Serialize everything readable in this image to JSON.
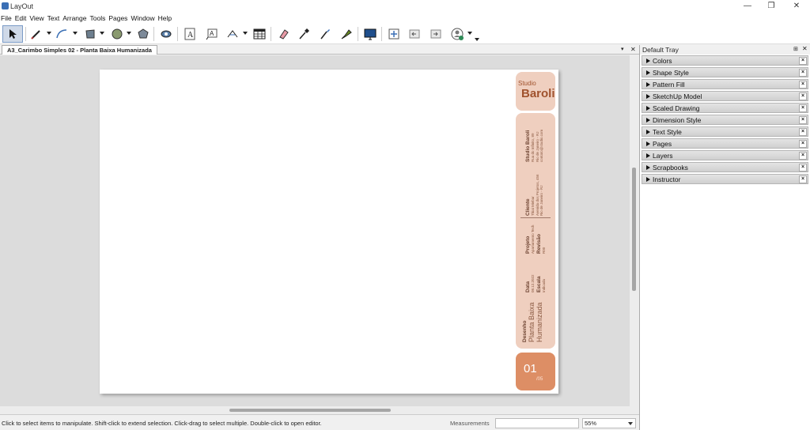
{
  "window": {
    "title": "LayOut",
    "minimize": "—",
    "maximize": "❐",
    "close": "✕"
  },
  "menu": [
    "File",
    "Edit",
    "View",
    "Text",
    "Arrange",
    "Tools",
    "Pages",
    "Window",
    "Help"
  ],
  "toolbar": {
    "tools": [
      "select",
      "line",
      "arc",
      "rectangle",
      "circle",
      "polygon",
      "style",
      "text",
      "label",
      "dimension",
      "table",
      "erase",
      "sample",
      "paint",
      "split",
      "presentation",
      "add-page",
      "previous-page",
      "next-page",
      "instructor"
    ]
  },
  "document": {
    "tab_label": "A3_Carimbo Simples 02 - Planta Baixa Humanizada",
    "tab_menu": "▾",
    "tab_close": "✕"
  },
  "title_block": {
    "studio": "Studio",
    "brand": "Baroli",
    "section1_label": "Studio Baroli",
    "section1_lines": [
      "Rua do Infinito, 89",
      "Rio de Janeiro - RJ",
      "contato@studio.com"
    ],
    "client_label": "Cliente",
    "client_lines": [
      "Thiai Miebar",
      "Avenida dos Projetos, 456",
      "Rio de Janeiro - RJ"
    ],
    "project_label": "Projeto",
    "project_value": "Apartamento Tech",
    "revision_label": "Revisão",
    "revision_value": "R00",
    "date_label": "Data",
    "date_value": "08.12.2022",
    "scale_label": "Escala",
    "scale_value": "Indicada",
    "drawing_label": "Desenho",
    "drawing_value": "Planta Baixa Humanizada",
    "page_number": "01",
    "page_total": "/05"
  },
  "tray": {
    "title": "Default Tray",
    "pin": "⊞",
    "close": "✕",
    "panels": [
      "Colors",
      "Shape Style",
      "Pattern Fill",
      "SketchUp Model",
      "Scaled Drawing",
      "Dimension Style",
      "Text Style",
      "Pages",
      "Layers",
      "Scrapbooks",
      "Instructor"
    ],
    "panel_close": "×"
  },
  "status": {
    "text": "Click to select items to manipulate. Shift-click to extend selection. Click-drag to select multiple. Double-click to open editor.",
    "measurements_label": "Measurements",
    "measurements_value": "",
    "zoom": "55%"
  },
  "colors": {
    "title_block_fill": "#efcfbf",
    "page_badge_fill": "#dd8e65",
    "brand_text": "#a0522d",
    "selection": "#cfd9e8"
  }
}
